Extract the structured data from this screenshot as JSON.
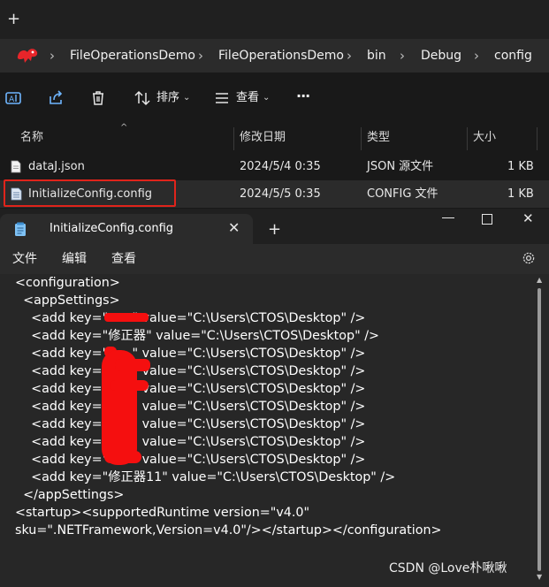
{
  "explorer": {
    "new_tab_symbol": "+",
    "breadcrumbs": [
      "FileOperationsDemo",
      "FileOperationsDemo",
      "bin",
      "Debug",
      "config"
    ],
    "breadcrumb_separator": "›",
    "toolbar": {
      "sort_label": "排序",
      "view_label": "查看",
      "more_label": "···"
    },
    "columns": [
      "名称",
      "修改日期",
      "类型",
      "大小"
    ],
    "files": [
      {
        "name": "dataJ.json",
        "modified": "2024/5/4 0:35",
        "type": "JSON 源文件",
        "size": "1 KB"
      },
      {
        "name": "InitializeConfig.config",
        "modified": "2024/5/5 0:35",
        "type": "CONFIG 文件",
        "size": "1 KB"
      }
    ],
    "highlight_color": "#e0241b"
  },
  "notepad": {
    "tab_title": "InitializeConfig.config",
    "new_tab_symbol": "+",
    "menu": [
      "文件",
      "编辑",
      "查看"
    ],
    "code_lines": [
      "<configuration>",
      "  <appSettings>",
      "    <add key=\"      \" value=\"C:\\Users\\CTOS\\Desktop\" />",
      "    <add key=\"修正器\" value=\"C:\\Users\\CTOS\\Desktop\" />",
      "    <add key=\"      \" value=\"C:\\Users\\CTOS\\Desktop\" />",
      "    <add key=\"      \" value=\"C:\\Users\\CTOS\\Desktop\" />",
      "    <add key=\"      \" value=\"C:\\Users\\CTOS\\Desktop\" />",
      "    <add key=\"      \" value=\"C:\\Users\\CTOS\\Desktop\" />",
      "    <add key=\"      \" value=\"C:\\Users\\CTOS\\Desktop\" />",
      "    <add key=\"      \" value=\"C:\\Users\\CTOS\\Desktop\" />",
      "    <add key=\"      \" value=\"C:\\Users\\CTOS\\Desktop\" />",
      "    <add key=\"修正器11\" value=\"C:\\Users\\CTOS\\Desktop\" />",
      "  </appSettings>",
      "<startup><supportedRuntime version=\"v4.0\"",
      "sku=\".NETFramework,Version=v4.0\"/></startup></configuration>"
    ],
    "redaction_color": "#f50f0f"
  },
  "watermark": "CSDN @Love朴啾啾"
}
